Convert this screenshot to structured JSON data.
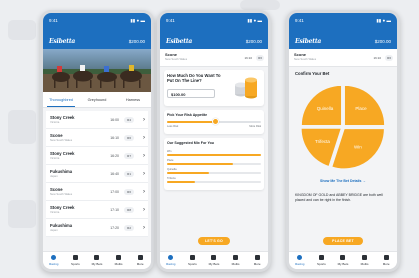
{
  "app": {
    "logo": "Esibetta",
    "balance": "$200.00",
    "status_time": "9:41",
    "status_icons": "▮▮ ● ▬"
  },
  "screen1": {
    "tabs": [
      "Thoroughbred",
      "Greyhound",
      "Harness"
    ],
    "races": [
      {
        "name": "Stony Creek",
        "sub": "Victoria",
        "time": "16:00",
        "badge": "R4"
      },
      {
        "name": "Scone",
        "sub": "New South Wales",
        "time": "16:10",
        "badge": "R6"
      },
      {
        "name": "Stony Creek",
        "sub": "Victoria",
        "time": "16:20",
        "badge": "R7"
      },
      {
        "name": "Fukushima",
        "sub": "Japan",
        "time": "16:40",
        "badge": "R1"
      },
      {
        "name": "Scone",
        "sub": "New South Wales",
        "time": "17:00",
        "badge": "R6"
      },
      {
        "name": "Stony Creek",
        "sub": "Victoria",
        "time": "17:10",
        "badge": "R8"
      },
      {
        "name": "Fukushima",
        "sub": "Japan",
        "time": "17:20",
        "badge": "R2"
      }
    ]
  },
  "nav": [
    "Racing",
    "Sports",
    "My Bets",
    "Multis",
    "More"
  ],
  "screen2": {
    "race_name": "Scone",
    "race_sub": "New South Wales",
    "race_time": "16:10",
    "race_badge": "R6",
    "put_question": "How Much Do You Want To Put On The Line?",
    "amount": "$100.00",
    "risk_title": "Pick Your Risk Appetite",
    "risk_low": "Less Risk",
    "risk_high": "More Risk",
    "risk_level": 0.52,
    "mix_title": "Our Suggested Mix For You",
    "mix": [
      {
        "label": "Win",
        "fraction": 1.0
      },
      {
        "label": "Place",
        "fraction": 0.7
      },
      {
        "label": "Quinella",
        "fraction": 0.45
      },
      {
        "label": "Trifecta",
        "fraction": 0.3
      }
    ],
    "cta": "LET'S GO"
  },
  "screen3": {
    "race_name": "Scone",
    "race_sub": "New South Wales",
    "race_time": "16:10",
    "race_badge": "R6",
    "title": "Confirm Your Bet",
    "pie": [
      {
        "label": "Place",
        "value": 25
      },
      {
        "label": "Win",
        "value": 30
      },
      {
        "label": "Trifecta",
        "value": 20
      },
      {
        "label": "Quinella",
        "value": 25
      }
    ],
    "pie_color": "#f7a823",
    "details_link": "Show Me The Bet Details →",
    "details_text": "KINGDOM OF GOLD and ABBEY BRIDGE are both well placed and can be right in the finish.",
    "cta": "PLACE BET"
  }
}
